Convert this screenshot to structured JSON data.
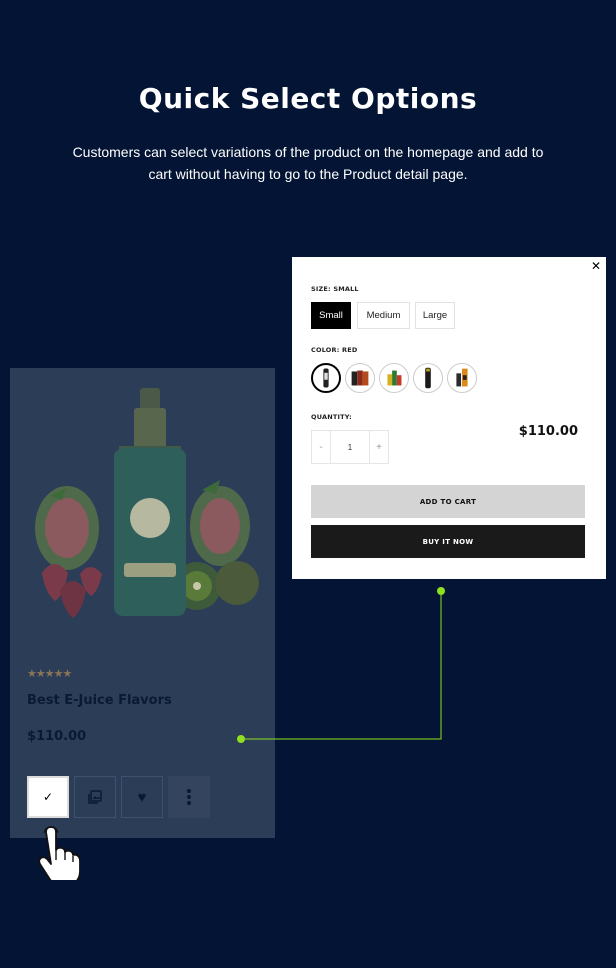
{
  "heading": {
    "title": "Quick Select Options",
    "subtitle": "Customers can select variations of the product on the homepage and add to cart without having to go to the Product detail page."
  },
  "product_card": {
    "rating_stars": "★★★★★",
    "name": "Best E-Juice Flavors",
    "price": "$110.00",
    "actions": [
      "check-icon",
      "gallery-icon",
      "heart-icon",
      "more-icon"
    ]
  },
  "popup": {
    "close": "✕",
    "size_label": "SIZE: SMALL",
    "sizes": [
      "Small",
      "Medium",
      "Large"
    ],
    "selected_size": "Small",
    "color_label": "COLOR: RED",
    "color_swatches": 5,
    "quantity_label": "QUANTITY:",
    "quantity": {
      "minus": "-",
      "value": "1",
      "plus": "+"
    },
    "price": "$110.00",
    "add_to_cart": "ADD TO CART",
    "buy_now": "BUY IT NOW"
  },
  "colors": {
    "background": "#031434",
    "card": "#2c3d58",
    "connector": "#8fe01f"
  }
}
